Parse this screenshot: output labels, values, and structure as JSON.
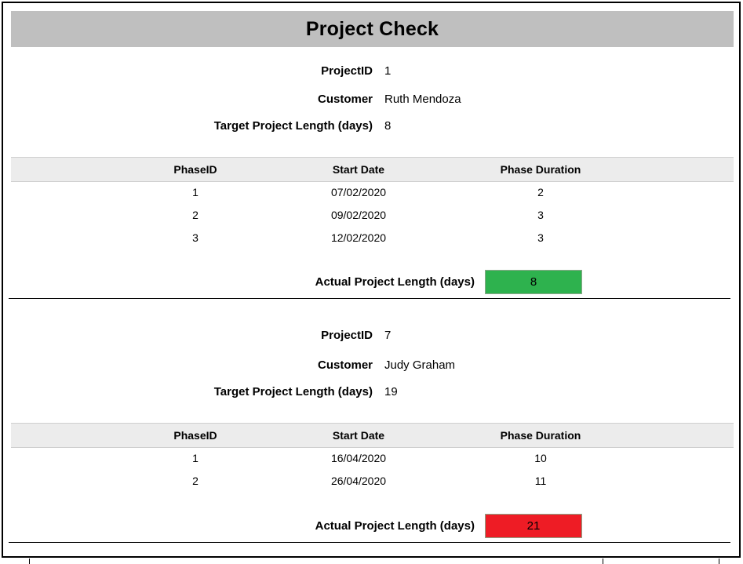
{
  "title": "Project Check",
  "labels": {
    "project_id": "ProjectID",
    "customer": "Customer",
    "target_length": "Target Project Length (days)",
    "actual_length": "Actual Project Length (days)"
  },
  "columns": [
    "PhaseID",
    "Start Date",
    "Phase Duration"
  ],
  "projects": [
    {
      "project_id": "1",
      "customer": "Ruth Mendoza",
      "target_length": "8",
      "phases": [
        {
          "phase_id": "1",
          "start_date": "07/02/2020",
          "duration": "2"
        },
        {
          "phase_id": "2",
          "start_date": "09/02/2020",
          "duration": "3"
        },
        {
          "phase_id": "3",
          "start_date": "12/02/2020",
          "duration": "3"
        }
      ],
      "actual_length": "8",
      "status_color": "#2eb24e"
    },
    {
      "project_id": "7",
      "customer": "Judy Graham",
      "target_length": "19",
      "phases": [
        {
          "phase_id": "1",
          "start_date": "16/04/2020",
          "duration": "10"
        },
        {
          "phase_id": "2",
          "start_date": "26/04/2020",
          "duration": "11"
        }
      ],
      "actual_length": "21",
      "status_color": "#ee1c25"
    }
  ],
  "colors": {
    "title_bar": "#bfbfbf",
    "header_bar": "#ececec",
    "on_target": "#2eb24e",
    "over_target": "#ee1c25"
  }
}
